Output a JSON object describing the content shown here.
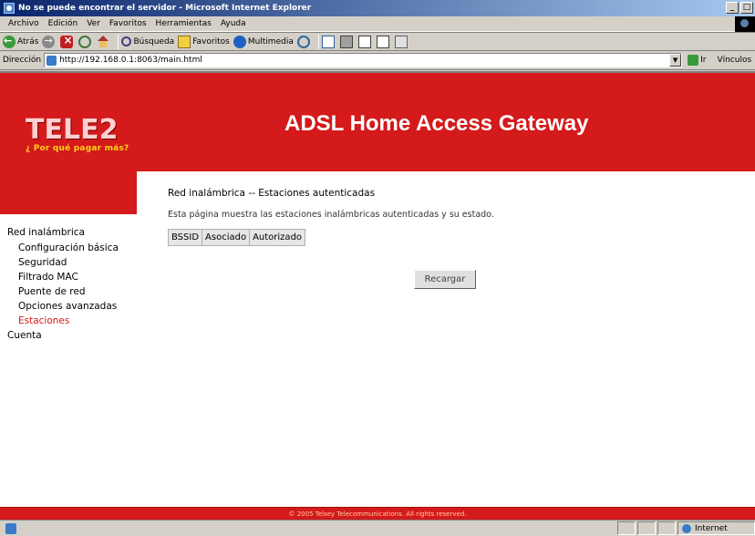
{
  "window": {
    "title": "No se puede encontrar el servidor - Microsoft Internet Explorer"
  },
  "menu": [
    "Archivo",
    "Edición",
    "Ver",
    "Favoritos",
    "Herramientas",
    "Ayuda"
  ],
  "toolbar": {
    "back_label": "Atrás",
    "search_label": "Búsqueda",
    "favorites_label": "Favoritos",
    "media_label": "Multimedia"
  },
  "address": {
    "label": "Dirección",
    "url": "http://192.168.0.1:8063/main.html",
    "go_label": "Ir",
    "links_label": "Vínculos"
  },
  "header": {
    "logo_text": "TELE2",
    "logo_tagline": "¿ Por qué pagar más?",
    "banner_title": "ADSL Home Access Gateway"
  },
  "sidebar": {
    "items": [
      {
        "label": "Red inalámbrica",
        "level": 0,
        "active": false
      },
      {
        "label": "Configuración básica",
        "level": 1,
        "active": false
      },
      {
        "label": "Seguridad",
        "level": 1,
        "active": false
      },
      {
        "label": "Filtrado MAC",
        "level": 1,
        "active": false
      },
      {
        "label": "Puente de red",
        "level": 1,
        "active": false
      },
      {
        "label": "Opciones avanzadas",
        "level": 1,
        "active": false
      },
      {
        "label": "Estaciones",
        "level": 1,
        "active": true
      },
      {
        "label": "Cuenta",
        "level": 0,
        "active": false
      }
    ]
  },
  "main": {
    "title": "Red inalámbrica -- Estaciones autenticadas",
    "description": "Esta página muestra las estaciones inalámbricas autenticadas y su estado.",
    "table_headers": [
      "BSSID",
      "Asociado",
      "Autorizado"
    ],
    "reload_label": "Recargar"
  },
  "footer": {
    "copyright": "© 2005 Telsey Telecommunications. All rights reserved."
  },
  "status": {
    "zone_label": "Internet"
  },
  "colors": {
    "brand_red": "#d41a1a",
    "active_link": "#d41a1a",
    "tagline_yellow": "#ffd21a"
  }
}
